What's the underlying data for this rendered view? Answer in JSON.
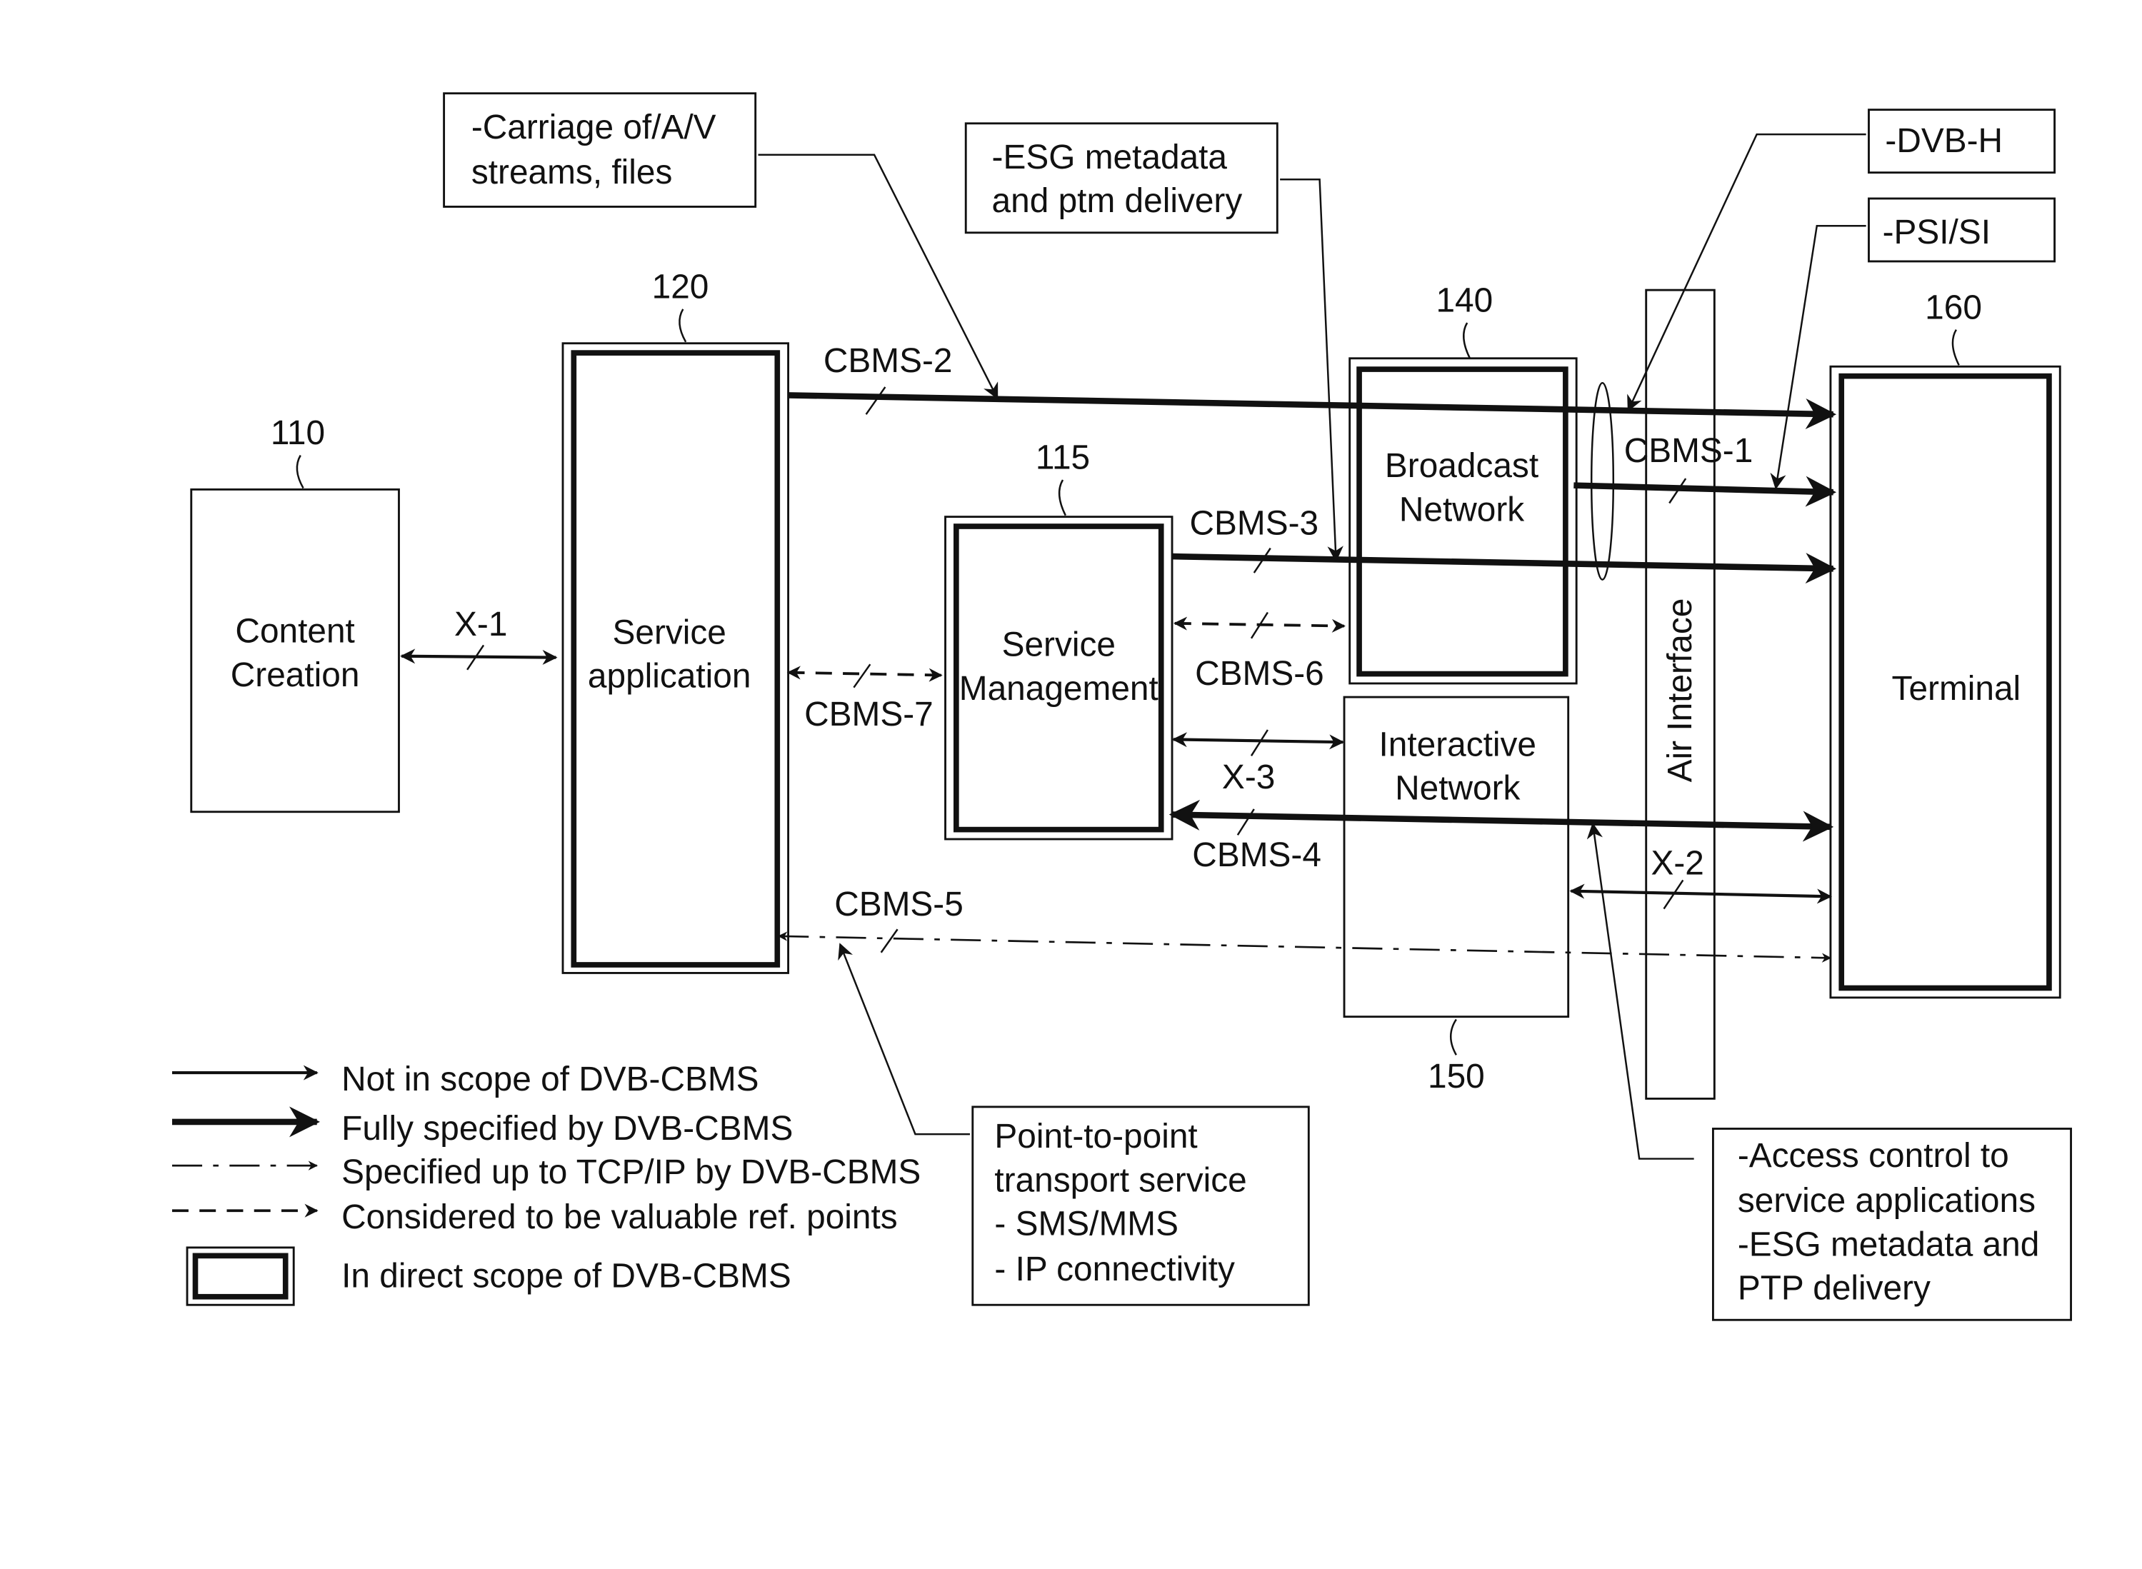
{
  "nodes": {
    "content_creation": {
      "ref": "110",
      "label_lines": [
        "Content",
        "Creation"
      ]
    },
    "service_application": {
      "ref": "120",
      "label_lines": [
        "Service",
        "application"
      ]
    },
    "service_management": {
      "ref": "115",
      "label_lines": [
        "Service",
        "Management"
      ]
    },
    "broadcast_network": {
      "ref": "140",
      "label_lines": [
        "Broadcast",
        "Network"
      ]
    },
    "interactive_network": {
      "ref": "150",
      "label_lines": [
        "Interactive",
        "Network"
      ]
    },
    "terminal": {
      "ref": "160",
      "label_lines": [
        "Terminal"
      ]
    },
    "air_interface": {
      "label": "Air Interface"
    }
  },
  "links": {
    "x1": "X-1",
    "cbms1": "CBMS-1",
    "cbms2": "CBMS-2",
    "cbms3": "CBMS-3",
    "cbms4": "CBMS-4",
    "cbms5": "CBMS-5",
    "cbms6": "CBMS-6",
    "cbms7": "CBMS-7",
    "x2": "X-2",
    "x3": "X-3"
  },
  "callouts": {
    "carriage": [
      "-Carriage of/A/V",
      "streams, files"
    ],
    "esg_ptm": [
      "-ESG metadata",
      "and ptm delivery"
    ],
    "dvbh": [
      "-DVB-H"
    ],
    "psisi": [
      "-PSI/SI"
    ],
    "ptp": [
      "Point-to-point",
      "transport service",
      "- SMS/MMS",
      "- IP connectivity"
    ],
    "access": [
      "-Access control to",
      "service applications",
      "-ESG metadata and",
      "PTP delivery"
    ]
  },
  "legend": [
    {
      "style": "thin-arrow",
      "label": "Not in scope of DVB-CBMS"
    },
    {
      "style": "thick-arrow",
      "label": "Fully specified by DVB-CBMS"
    },
    {
      "style": "dash-dot-arrow",
      "label": "Specified up to TCP/IP by DVB-CBMS"
    },
    {
      "style": "dashed-arrow",
      "label": "Considered to be valuable ref. points"
    },
    {
      "style": "double-box",
      "label": "In direct scope of DVB-CBMS"
    }
  ]
}
